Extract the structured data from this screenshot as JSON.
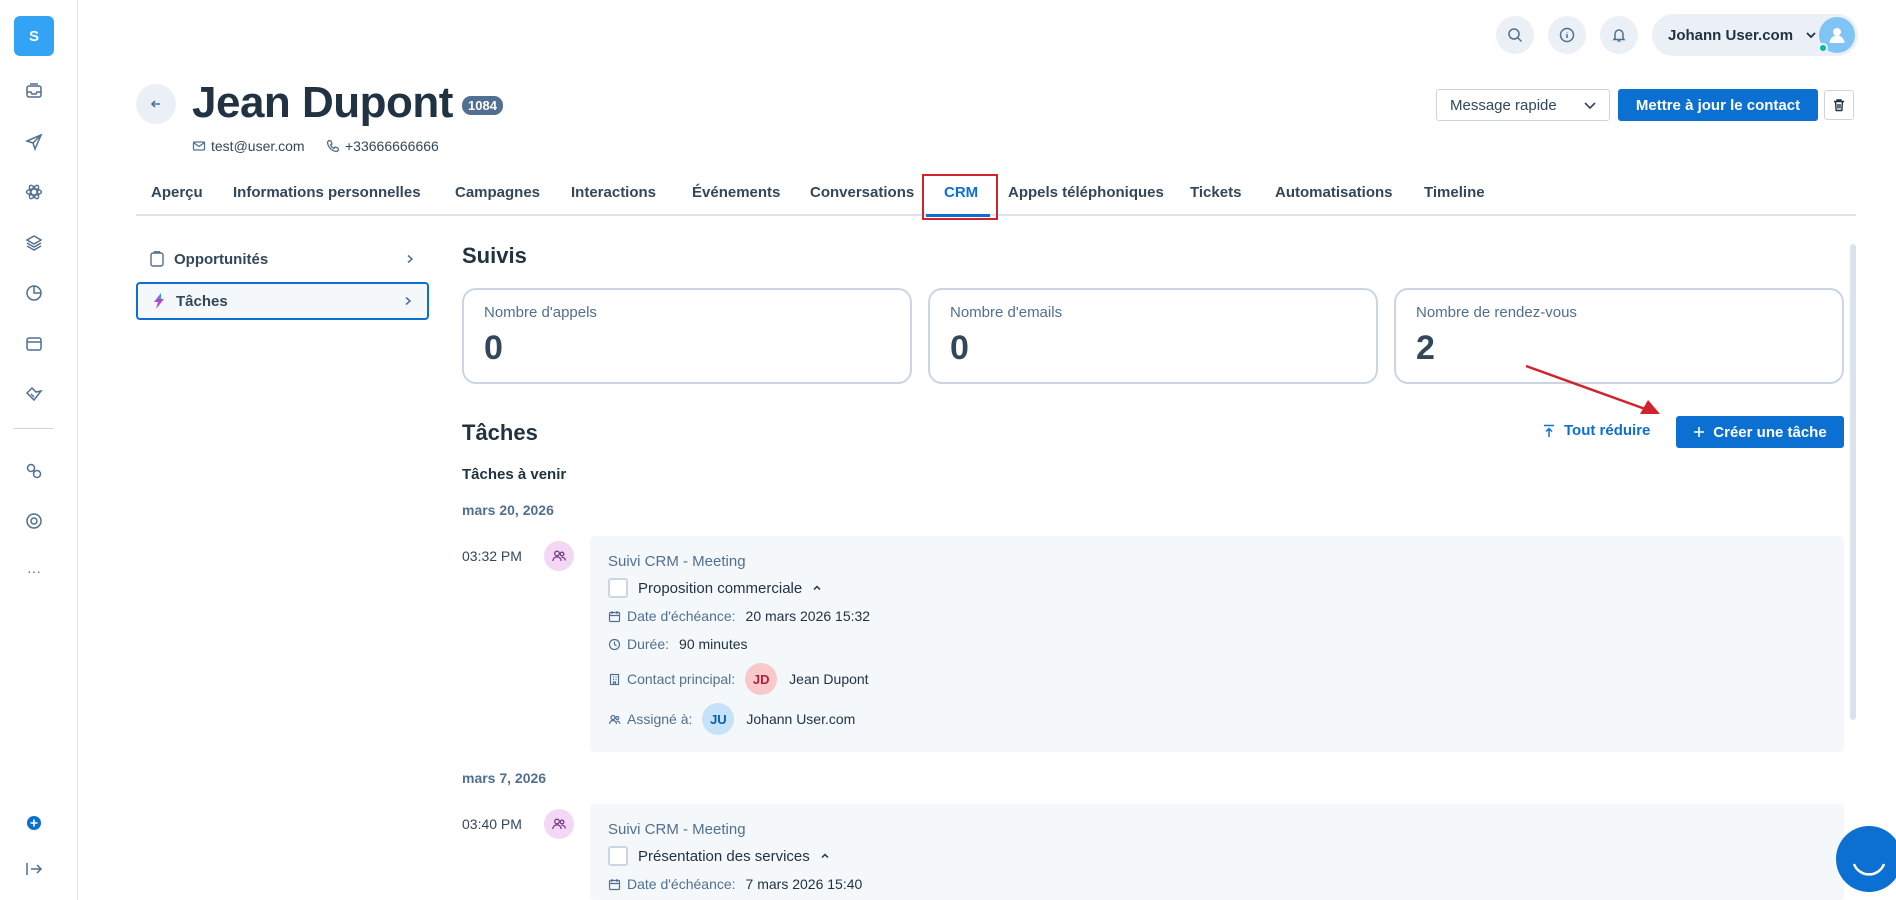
{
  "sidebar": {
    "logo_letter": "S"
  },
  "topbar": {
    "user_name": "Johann User.com"
  },
  "contact": {
    "name": "Jean Dupont",
    "id_badge": "1084",
    "email": "test@user.com",
    "phone": "+33666666666"
  },
  "actions": {
    "quick_message": "Message rapide",
    "update_contact": "Mettre à jour le contact"
  },
  "tabs": [
    {
      "label": "Aperçu"
    },
    {
      "label": "Informations personnelles"
    },
    {
      "label": "Campagnes"
    },
    {
      "label": "Interactions"
    },
    {
      "label": "Événements"
    },
    {
      "label": "Conversations"
    },
    {
      "label": "CRM"
    },
    {
      "label": "Appels téléphoniques"
    },
    {
      "label": "Tickets"
    },
    {
      "label": "Automatisations"
    },
    {
      "label": "Timeline"
    }
  ],
  "active_tab": "CRM",
  "leftnav": [
    {
      "label": "Opportunités"
    },
    {
      "label": "Tâches"
    }
  ],
  "suivis": {
    "title": "Suivis",
    "cards": [
      {
        "label": "Nombre d'appels",
        "value": "0"
      },
      {
        "label": "Nombre d'emails",
        "value": "0"
      },
      {
        "label": "Nombre de rendez-vous",
        "value": "2"
      }
    ]
  },
  "taches": {
    "title": "Tâches",
    "collapse_label": "Tout réduire",
    "create_label": "Créer une tâche",
    "upcoming_label": "Tâches à venir",
    "items": [
      {
        "date": "mars 20, 2026",
        "time": "03:32 PM",
        "type": "Suivi CRM - Meeting",
        "title": "Proposition commerciale",
        "due_label": "Date d'échéance:",
        "due_value": "20 mars 2026 15:32",
        "duration_label": "Durée:",
        "duration_value": "90 minutes",
        "contact_label": "Contact principal:",
        "contact_initials": "JD",
        "contact_name": "Jean Dupont",
        "assigned_label": "Assigné à:",
        "assigned_initials": "JU",
        "assigned_name": "Johann User.com"
      },
      {
        "date": "mars 7, 2026",
        "time": "03:40 PM",
        "type": "Suivi CRM - Meeting",
        "title": "Présentation des services",
        "due_label": "Date d'échéance:",
        "due_value": "7 mars 2026 15:40"
      }
    ]
  },
  "colors": {
    "accent": "#0b70d1",
    "highlight": "#d2222d",
    "logo": "#33a3f5"
  }
}
